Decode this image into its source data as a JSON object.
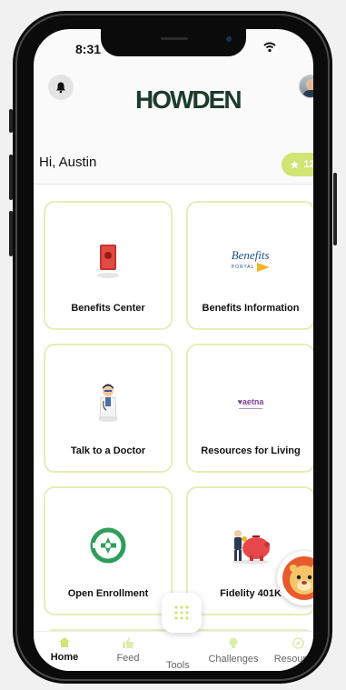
{
  "status_bar": {
    "time": "8:31"
  },
  "header": {
    "logo_text": "HOWDEN"
  },
  "greeting": "Hi, Austin",
  "points_badge": {
    "value": "12"
  },
  "tiles": [
    {
      "label": "Benefits Center",
      "icon": "book-icon"
    },
    {
      "label": "Benefits Information",
      "icon": "benefits-portal-logo",
      "logo_text": "Benefits",
      "logo_sub": "PORTAL"
    },
    {
      "label": "Talk to a Doctor",
      "icon": "doctor-icon"
    },
    {
      "label": "Resources for Living",
      "icon": "aetna-logo",
      "logo_text": "♥aetna"
    },
    {
      "label": "Open Enrollment",
      "icon": "enrollment-icon"
    },
    {
      "label": "Fidelity 401K",
      "icon": "piggy-bank-icon"
    }
  ],
  "tabbar": {
    "tabs": [
      {
        "label": "Home",
        "icon": "home-icon",
        "active": true
      },
      {
        "label": "Feed",
        "icon": "thumbs-up-icon"
      },
      {
        "label": "Tools",
        "icon": "grid-icon"
      },
      {
        "label": "Challenges",
        "icon": "lightbulb-icon"
      },
      {
        "label": "Resources",
        "icon": "compass-icon"
      }
    ]
  },
  "colors": {
    "accent_green": "#cfe574",
    "tile_border": "#e3efb8",
    "brand_dark": "#1c3b2c"
  }
}
